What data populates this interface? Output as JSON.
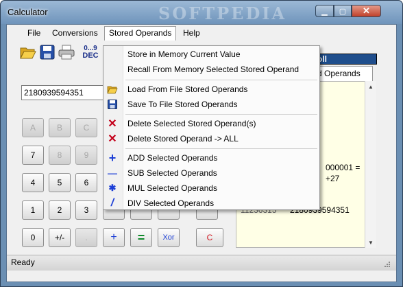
{
  "window": {
    "title": "Calculator",
    "watermark": "SOFTPEDIA"
  },
  "menu": {
    "file": "File",
    "conversions": "Conversions",
    "stored_operands": "Stored Operands",
    "help": "Help"
  },
  "toolbar": {
    "dec_label_top": "0...9",
    "dec_label_bottom": "DEC"
  },
  "display": {
    "value": "2180939594351"
  },
  "buttons": {
    "row1": [
      "A",
      "B",
      "C"
    ],
    "row2": [
      "7",
      "8",
      "9"
    ],
    "row3": [
      "4",
      "5",
      "6"
    ],
    "row4": [
      "1",
      "2",
      "3"
    ],
    "row5": [
      "0",
      "+/-",
      ".",
      "+",
      "=",
      "Xor",
      "C"
    ]
  },
  "stored_panel": {
    "header": "oll",
    "tab": "d Operands",
    "line1": "000001 =",
    "line2": "+27",
    "line3": "2180939594351",
    "line3_partial": "11236315"
  },
  "dropdown": {
    "items": [
      {
        "label": "Store in Memory Current Value"
      },
      {
        "label": "Recall From Memory Selected Stored Operand"
      },
      {
        "label": "Load From File Stored Operands"
      },
      {
        "label": "Save To File Stored Operands"
      },
      {
        "label": "Delete Selected Stored Operand(s)"
      },
      {
        "label": "Delete Stored Operand -> ALL"
      },
      {
        "label": "ADD Selected Operands"
      },
      {
        "label": "SUB Selected Operands"
      },
      {
        "label": "MUL Selected Operands"
      },
      {
        "label": "DIV Selected Operands"
      }
    ],
    "glyphs": {
      "delete": "✕",
      "add": "+",
      "sub": "—",
      "mul": "✱",
      "div": "/"
    }
  },
  "status": {
    "text": "Ready"
  },
  "colors": {
    "accent_blue": "#1f4e8c",
    "delete_red": "#c4001a",
    "equals_green": "#0f8a2a",
    "clear_red": "#d0121c",
    "op_blue": "#1d3fd6"
  }
}
